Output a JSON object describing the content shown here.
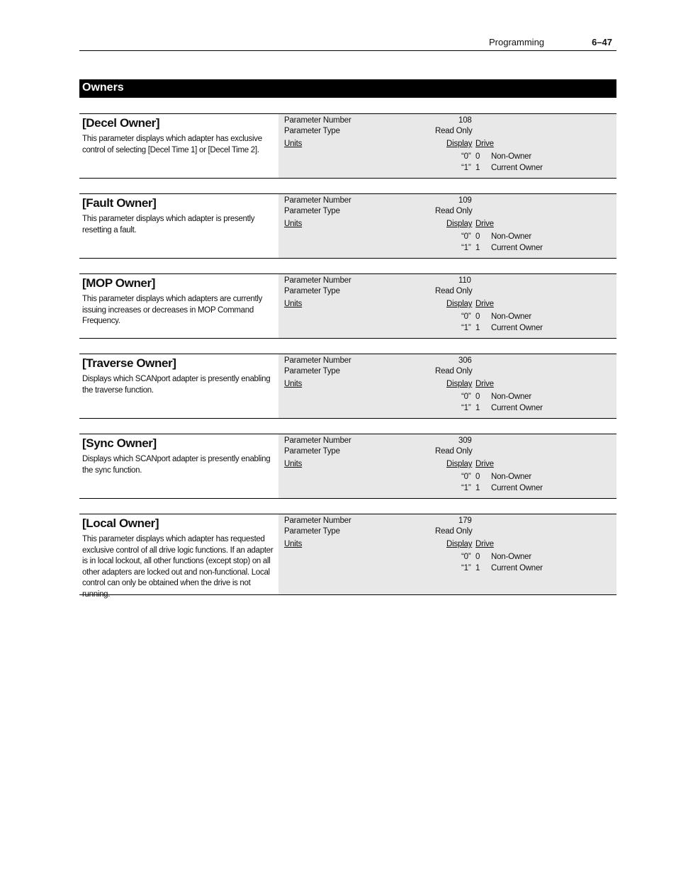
{
  "header": {
    "section": "Programming",
    "page_number": "6–47"
  },
  "banner": {
    "title": "Owners"
  },
  "labels": {
    "parameter_number": "Parameter Number",
    "parameter_type": "Parameter Type",
    "units": "Units",
    "display": "Display",
    "drive": "Drive"
  },
  "parameters": [
    {
      "title": "[Decel Owner]",
      "description": "This parameter displays which adapter has exclusive control of selecting [Decel Time 1] or [Decel Time 2].",
      "number": "108",
      "type": "Read Only",
      "values": [
        {
          "display": "“0”",
          "drive": "0",
          "meaning": "Non-Owner"
        },
        {
          "display": "“1”",
          "drive": "1",
          "meaning": "Current Owner"
        }
      ]
    },
    {
      "title": "[Fault Owner]",
      "description": "This parameter displays which adapter is presently resetting a fault.",
      "number": "109",
      "type": "Read Only",
      "values": [
        {
          "display": "“0”",
          "drive": "0",
          "meaning": "Non-Owner"
        },
        {
          "display": "“1”",
          "drive": "1",
          "meaning": "Current Owner"
        }
      ]
    },
    {
      "title": "[MOP Owner]",
      "description": "This parameter displays which adapters are currently issuing increases or decreases in MOP Command Frequency.",
      "number": "110",
      "type": "Read Only",
      "values": [
        {
          "display": "“0”",
          "drive": "0",
          "meaning": "Non-Owner"
        },
        {
          "display": "“1”",
          "drive": "1",
          "meaning": "Current Owner"
        }
      ]
    },
    {
      "title": "[Traverse Owner]",
      "description": "Displays which SCANport adapter is presently enabling the traverse function.",
      "number": "306",
      "type": "Read Only",
      "values": [
        {
          "display": "“0”",
          "drive": "0",
          "meaning": "Non-Owner"
        },
        {
          "display": "“1”",
          "drive": "1",
          "meaning": "Current Owner"
        }
      ]
    },
    {
      "title": "[Sync Owner]",
      "description": "Displays which SCANport adapter is presently enabling the sync function.",
      "number": "309",
      "type": "Read Only",
      "values": [
        {
          "display": "“0”",
          "drive": "0",
          "meaning": "Non-Owner"
        },
        {
          "display": "“1”",
          "drive": "1",
          "meaning": "Current Owner"
        }
      ]
    },
    {
      "title": "[Local Owner]",
      "description": "This parameter displays which adapter has requested exclusive control of all drive logic functions. If an adapter is in local lockout, all other functions (except stop) on all other adapters are locked out and non-functional. Local control can only be obtained when the drive is not running.",
      "number": "179",
      "type": "Read Only",
      "values": [
        {
          "display": "“0”",
          "drive": "0",
          "meaning": "Non-Owner"
        },
        {
          "display": "“1”",
          "drive": "1",
          "meaning": "Current Owner"
        }
      ]
    }
  ]
}
